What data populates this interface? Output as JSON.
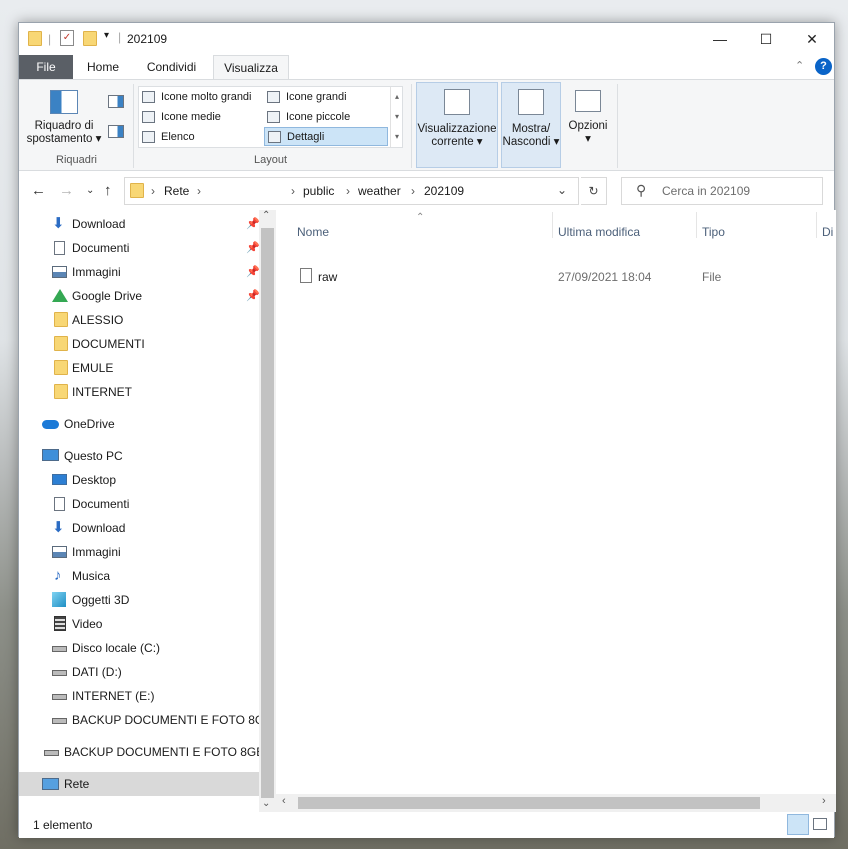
{
  "window": {
    "title": "202109",
    "controls": {
      "minimize": "—",
      "maximize": "☐",
      "close": "✕"
    }
  },
  "ribbon": {
    "tabs": [
      {
        "label": "File"
      },
      {
        "label": "Home"
      },
      {
        "label": "Condividi"
      },
      {
        "label": "Visualizza"
      }
    ],
    "panes_group": {
      "nav_pane_label": "Riquadro di spostamento",
      "group_label": "Riquadri"
    },
    "layout_group": {
      "items": [
        "Icone molto grandi",
        "Icone grandi",
        "Icone medie",
        "Icone piccole",
        "Elenco",
        "Dettagli"
      ],
      "selected": "Dettagli",
      "group_label": "Layout"
    },
    "current_view_label": "Visualizzazione corrente",
    "show_hide_label": "Mostra/ Nascondi",
    "options_label": "Opzioni"
  },
  "address_bar": {
    "crumbs": [
      "Rete",
      "public",
      "weather",
      "202109"
    ],
    "search_placeholder": "Cerca in 202109"
  },
  "nav_pane": {
    "quick_access": [
      {
        "label": "Download",
        "icon": "download-arrow-icon",
        "pinned": true
      },
      {
        "label": "Documenti",
        "icon": "document-icon",
        "pinned": true
      },
      {
        "label": "Immagini",
        "icon": "pictures-icon",
        "pinned": true
      },
      {
        "label": "Google Drive",
        "icon": "google-drive-icon",
        "pinned": true
      },
      {
        "label": "ALESSIO",
        "icon": "folder-icon"
      },
      {
        "label": "DOCUMENTI",
        "icon": "folder-icon"
      },
      {
        "label": "EMULE",
        "icon": "folder-icon"
      },
      {
        "label": "INTERNET",
        "icon": "folder-icon"
      }
    ],
    "onedrive": "OneDrive",
    "this_pc": "Questo PC",
    "pc_items": [
      {
        "label": "Desktop",
        "icon": "desktop-icon"
      },
      {
        "label": "Documenti",
        "icon": "document-icon"
      },
      {
        "label": "Download",
        "icon": "download-arrow-icon"
      },
      {
        "label": "Immagini",
        "icon": "pictures-icon"
      },
      {
        "label": "Musica",
        "icon": "music-note-icon"
      },
      {
        "label": "Oggetti 3D",
        "icon": "cube-3d-icon"
      },
      {
        "label": "Video",
        "icon": "film-icon"
      },
      {
        "label": "Disco locale (C:)",
        "icon": "drive-icon"
      },
      {
        "label": "DATI (D:)",
        "icon": "drive-icon"
      },
      {
        "label": "INTERNET (E:)",
        "icon": "drive-icon"
      },
      {
        "label": "BACKUP DOCUMENTI E FOTO 8GB (",
        "icon": "drive-icon"
      }
    ],
    "external_drive": "BACKUP DOCUMENTI E FOTO 8GB (H",
    "network": "Rete"
  },
  "file_list": {
    "columns": [
      "Nome",
      "Ultima modifica",
      "Tipo",
      "Di"
    ],
    "rows": [
      {
        "name": "raw",
        "modified": "27/09/2021 18:04",
        "type": "File"
      }
    ]
  },
  "status_bar": {
    "item_count": "1 elemento"
  },
  "colors": {
    "file_tab": "#5a5f66",
    "selection": "#cce4f7",
    "header_text": "#4c607a",
    "accent": "#0a64c8"
  }
}
